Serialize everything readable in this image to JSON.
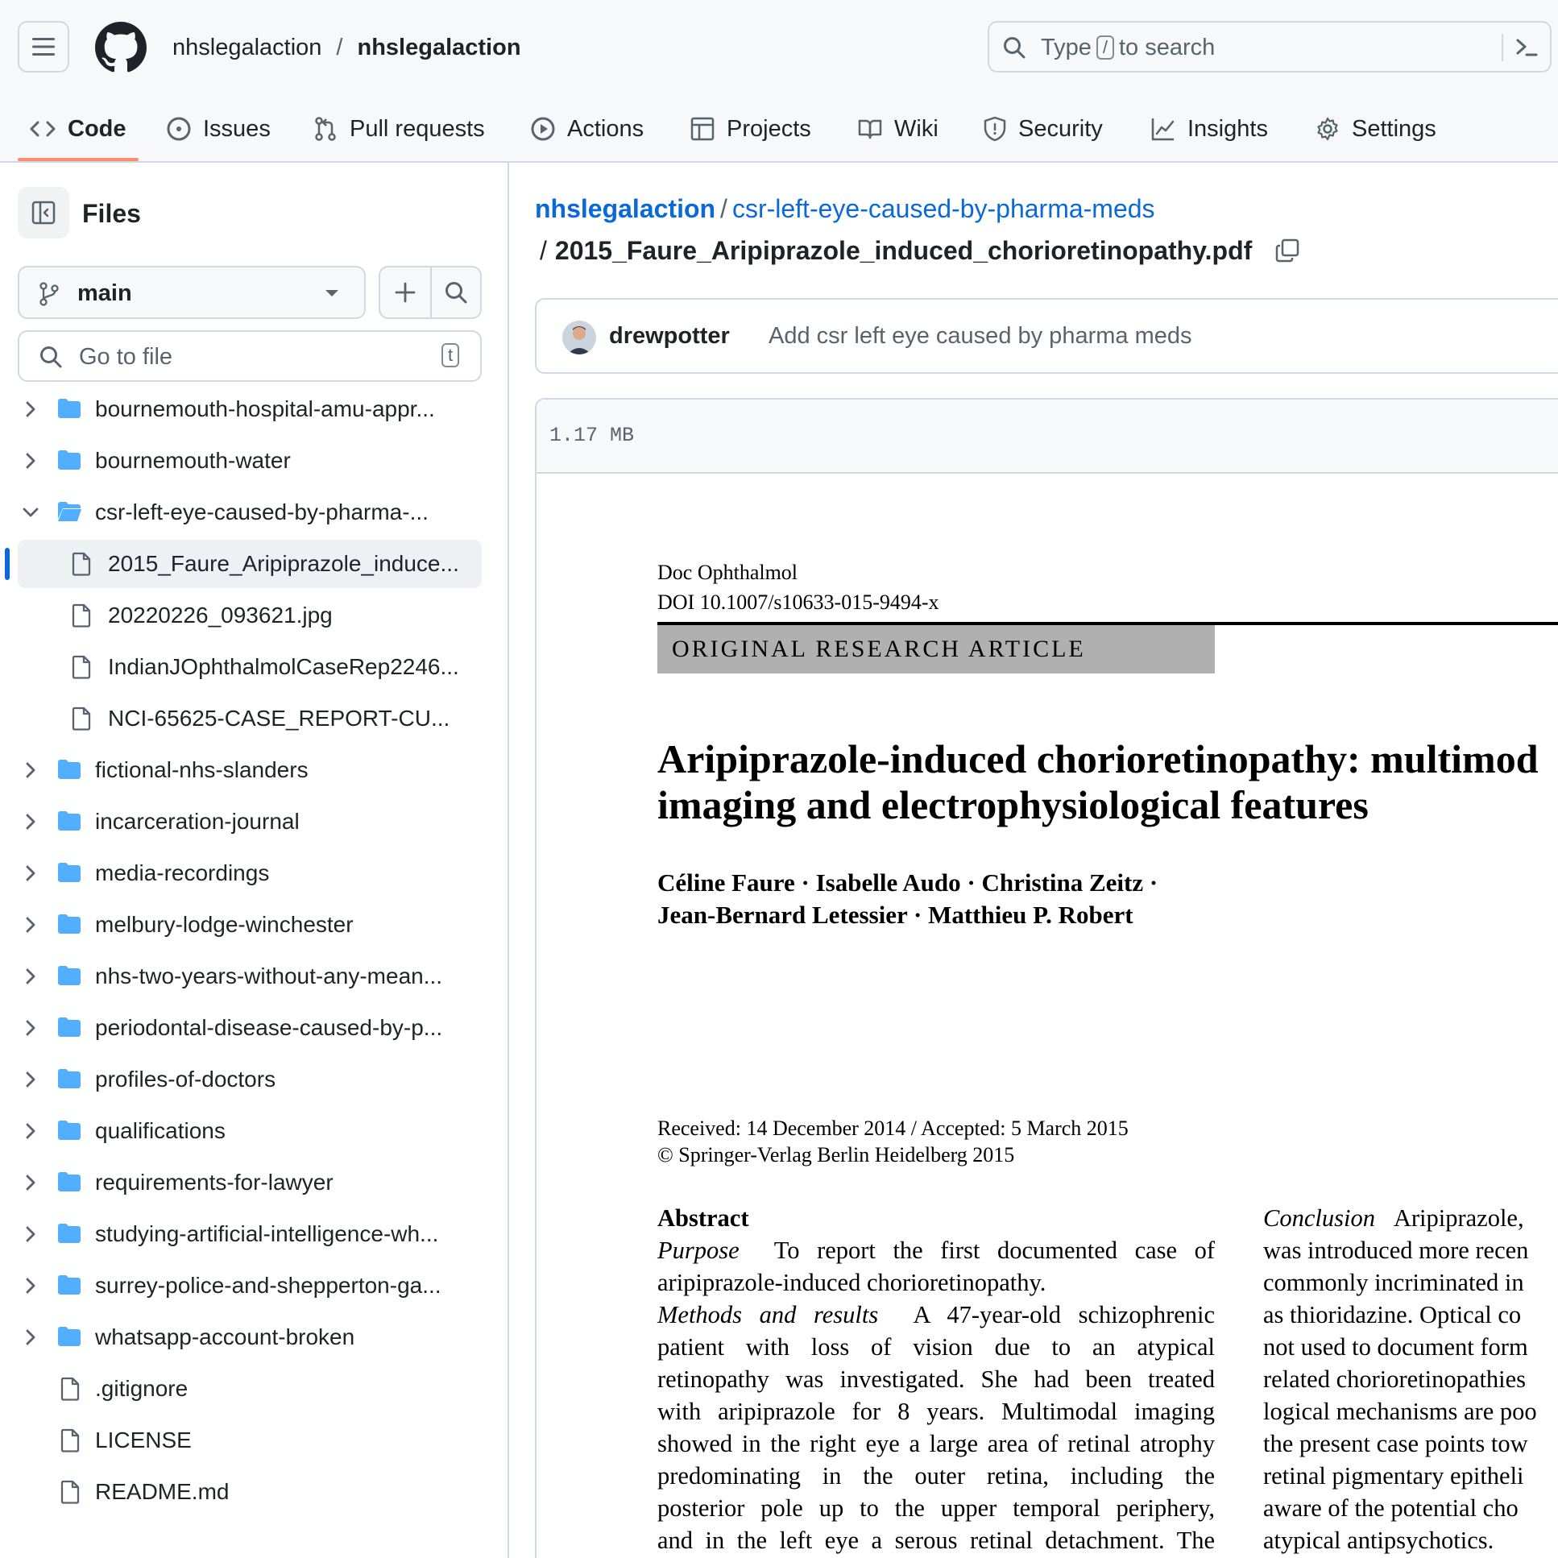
{
  "header": {
    "owner": "nhslegalaction",
    "separator": "/",
    "repo": "nhslegalaction",
    "search": {
      "prefix": "Type",
      "key": "/",
      "suffix": "to search"
    }
  },
  "tabs": [
    {
      "label": "Code",
      "icon": "code-icon",
      "active": true
    },
    {
      "label": "Issues",
      "icon": "issue-icon"
    },
    {
      "label": "Pull requests",
      "icon": "pull-request-icon"
    },
    {
      "label": "Actions",
      "icon": "play-icon"
    },
    {
      "label": "Projects",
      "icon": "table-icon"
    },
    {
      "label": "Wiki",
      "icon": "book-icon"
    },
    {
      "label": "Security",
      "icon": "shield-icon"
    },
    {
      "label": "Insights",
      "icon": "graph-icon"
    },
    {
      "label": "Settings",
      "icon": "gear-icon"
    }
  ],
  "sidebar": {
    "title": "Files",
    "branch": "main",
    "goto_placeholder": "Go to file",
    "goto_key": "t",
    "tree": [
      {
        "label": "bournemouth-hospital-amu-appr...",
        "type": "folder",
        "expanded": false
      },
      {
        "label": "bournemouth-water",
        "type": "folder",
        "expanded": false
      },
      {
        "label": "csr-left-eye-caused-by-pharma-...",
        "type": "folder",
        "expanded": true
      },
      {
        "label": "2015_Faure_Aripiprazole_induce...",
        "type": "file",
        "child": true,
        "selected": true
      },
      {
        "label": "20220226_093621.jpg",
        "type": "file",
        "child": true
      },
      {
        "label": "IndianJOphthalmolCaseRep2246...",
        "type": "file",
        "child": true
      },
      {
        "label": "NCI-65625-CASE_REPORT-CU...",
        "type": "file",
        "child": true
      },
      {
        "label": "fictional-nhs-slanders",
        "type": "folder",
        "expanded": false
      },
      {
        "label": "incarceration-journal",
        "type": "folder",
        "expanded": false
      },
      {
        "label": "media-recordings",
        "type": "folder",
        "expanded": false
      },
      {
        "label": "melbury-lodge-winchester",
        "type": "folder",
        "expanded": false
      },
      {
        "label": "nhs-two-years-without-any-mean...",
        "type": "folder",
        "expanded": false
      },
      {
        "label": "periodontal-disease-caused-by-p...",
        "type": "folder",
        "expanded": false
      },
      {
        "label": "profiles-of-doctors",
        "type": "folder",
        "expanded": false
      },
      {
        "label": "qualifications",
        "type": "folder",
        "expanded": false
      },
      {
        "label": "requirements-for-lawyer",
        "type": "folder",
        "expanded": false
      },
      {
        "label": "studying-artificial-intelligence-wh...",
        "type": "folder",
        "expanded": false
      },
      {
        "label": "surrey-police-and-shepperton-ga...",
        "type": "folder",
        "expanded": false
      },
      {
        "label": "whatsapp-account-broken",
        "type": "folder",
        "expanded": false
      },
      {
        "label": ".gitignore",
        "type": "file",
        "child": false
      },
      {
        "label": "LICENSE",
        "type": "file",
        "child": false
      },
      {
        "label": "README.md",
        "type": "file",
        "child": false
      }
    ]
  },
  "main": {
    "path_owner": "nhslegalaction",
    "path_dir": "csr-left-eye-caused-by-pharma-meds",
    "path_sep": "/",
    "file_name": "2015_Faure_Aripiprazole_induced_chorioretinopathy.pdf",
    "commit_author": "drewpotter",
    "commit_message": "Add csr left eye caused by pharma meds",
    "file_size": "1.17 MB"
  },
  "pdf": {
    "journal": "Doc Ophthalmol",
    "doi": "DOI 10.1007/s10633-015-9494-x",
    "banner": "ORIGINAL RESEARCH ARTICLE",
    "title_line1": "Aripiprazole-induced chorioretinopathy: multimod",
    "title_line2": "imaging and electrophysiological features",
    "authors_line1": "Céline Faure · Isabelle Audo · Christina Zeitz ·",
    "authors_line2": "Jean-Bernard Letessier · Matthieu P. Robert",
    "received": "Received: 14 December 2014 / Accepted: 5 March 2015",
    "copyright": "© Springer-Verlag Berlin Heidelberg 2015",
    "abstract_heading": "Abstract",
    "purpose_label": "Purpose",
    "purpose_line1": "To report the first documented case of",
    "purpose_line2": "aripiprazole-induced chorioretinopathy.",
    "methods_label": "Methods and results",
    "methods_line1": "A 47-year-old schizophrenic",
    "abstract_lines": [
      "patient with loss of vision due to an atypical",
      "retinopathy was investigated. She had been treated",
      "with aripiprazole for 8 years. Multimodal imaging",
      "showed in the right eye a large area of retinal atrophy",
      "predominating in the outer retina, including the",
      "posterior pole up to the upper temporal periphery,",
      "and in the left eye a serous retinal detachment. The"
    ],
    "conclusion_label": "Conclusion",
    "conclusion_line1": "Aripiprazole,",
    "right_lines": [
      "was introduced more recen",
      "commonly incriminated in",
      "as thioridazine. Optical co",
      "not used to document form",
      "related chorioretinopathies",
      "logical mechanisms are poo",
      "the present case points tow",
      "retinal pigmentary epitheli",
      "aware of the potential cho",
      "atypical antipsychotics."
    ]
  }
}
